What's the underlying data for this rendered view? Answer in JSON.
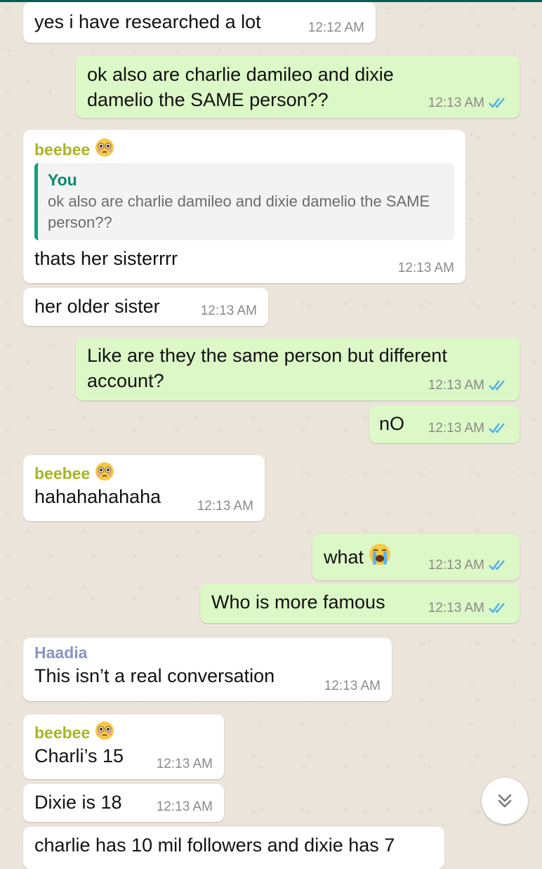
{
  "colors": {
    "incoming": "#ffffff",
    "outgoing": "#dcf8c6",
    "read_ticks": "#4fb0e6",
    "sender_beebee": "#a8b524",
    "sender_haadia": "#8a93c7",
    "quote_bar": "#129e7d"
  },
  "messages": [
    {
      "text": "yes i have researched a lot",
      "time": "12:12 AM"
    },
    {
      "text": "ok also are charlie damileo and dixie damelio the SAME person??",
      "time": "12:13 AM"
    },
    {
      "sender": "beebee",
      "quote_name": "You",
      "quote_text": "ok also are charlie damileo and dixie damelio the SAME person??",
      "text": "thats her sisterrrr",
      "time": "12:13 AM"
    },
    {
      "text": "her older sister",
      "time": "12:13 AM"
    },
    {
      "text": "Like are they the same person but different account?",
      "time": "12:13 AM"
    },
    {
      "text": "nO",
      "time": "12:13 AM"
    },
    {
      "sender": "beebee",
      "text": "hahahahahaha",
      "time": "12:13 AM"
    },
    {
      "text": "what",
      "time": "12:13 AM"
    },
    {
      "text": "Who is more famous",
      "time": "12:13 AM"
    },
    {
      "sender": "Haadia",
      "text": "This isn’t a real conversation",
      "time": "12:13 AM"
    },
    {
      "sender": "beebee",
      "text": "Charli’s 15",
      "time": "12:13 AM"
    },
    {
      "text": "Dixie is 18",
      "time": "12:13 AM"
    },
    {
      "text": "charlie has 10 mil followers and dixie has 7",
      "time": ""
    }
  ],
  "icons": {
    "emoji_flushed": "flushed-face-emoji",
    "emoji_crying": "loudly-crying-face-emoji",
    "read_receipt": "double-check-icon",
    "scroll_down": "chevron-double-down-icon"
  }
}
